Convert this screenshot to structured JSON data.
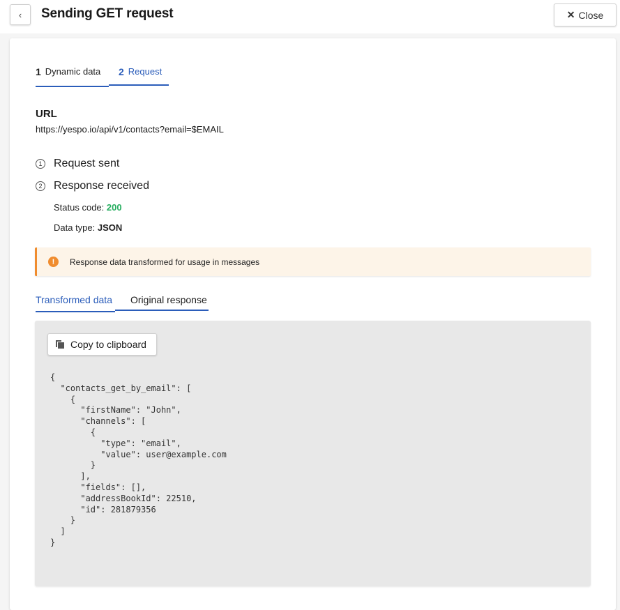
{
  "header": {
    "back_icon": "chevron-left-icon",
    "back_glyph": "‹",
    "title": "Sending GET request",
    "close_glyph": "✕",
    "close_label": "Close"
  },
  "steps": [
    {
      "number": "1",
      "label": "Dynamic data"
    },
    {
      "number": "2",
      "label": "Request"
    }
  ],
  "url": {
    "label": "URL",
    "value": "https://yespo.io/api/v1/contacts?email=$EMAIL"
  },
  "status": {
    "sent_num": "1",
    "sent_label": "Request sent",
    "received_num": "2",
    "received_label": "Response received",
    "status_code_label": "Status code:",
    "status_code_value": "200",
    "data_type_label": "Data type:",
    "data_type_value": "JSON"
  },
  "alert": {
    "icon": "warning-icon",
    "glyph": "!",
    "text": "Response data transformed for usage in messages"
  },
  "tabs": [
    {
      "label": "Transformed data",
      "active": true
    },
    {
      "label": "Original response",
      "active": false
    }
  ],
  "code_panel": {
    "copy_label": "Copy to clipboard",
    "copy_icon": "copy-icon",
    "lines": [
      "{",
      "  \"contacts_get_by_email\": [",
      "    {",
      "      \"firstName\": \"John\",",
      "      \"channels\": [",
      "        {",
      "          \"type\": \"email\",",
      "          \"value\": user@example.com",
      "        }",
      "      ],",
      "      \"fields\": [],",
      "      \"addressBookId\": 22510,",
      "      \"id\": 281879356",
      "    }",
      "  ]",
      "}"
    ]
  },
  "colors": {
    "accent": "#2b5dba",
    "success": "#27ae60",
    "warning": "#f08c2e"
  }
}
